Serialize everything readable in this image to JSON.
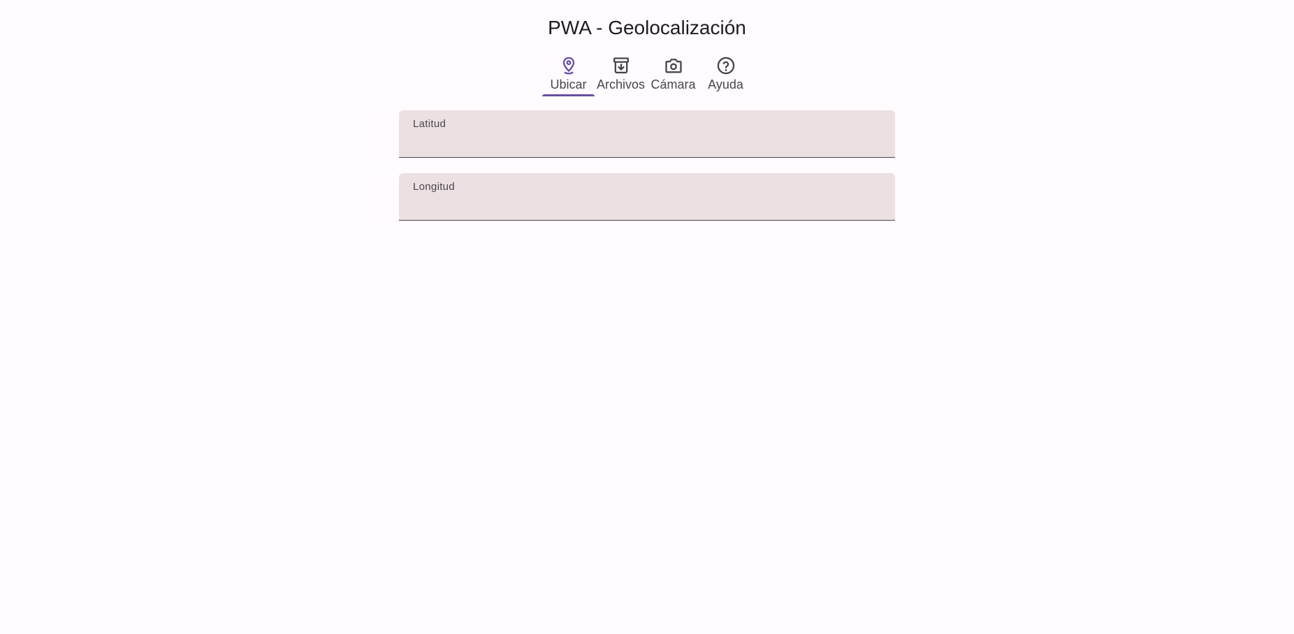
{
  "app": {
    "title": "PWA - Geolocalización"
  },
  "colors": {
    "background": "#fffbff",
    "primary": "#6750a4",
    "on_surface_variant": "#49454f",
    "field_fill": "#ece0e2"
  },
  "tabs": [
    {
      "label": "Ubicar",
      "icon": "location-pin-icon",
      "active": true
    },
    {
      "label": "Archivos",
      "icon": "archive-download-icon",
      "active": false
    },
    {
      "label": "Cámara",
      "icon": "camera-icon",
      "active": false
    },
    {
      "label": "Ayuda",
      "icon": "help-circle-icon",
      "active": false
    }
  ],
  "form": {
    "latitude": {
      "label": "Latitud",
      "value": ""
    },
    "longitude": {
      "label": "Longitud",
      "value": ""
    }
  }
}
